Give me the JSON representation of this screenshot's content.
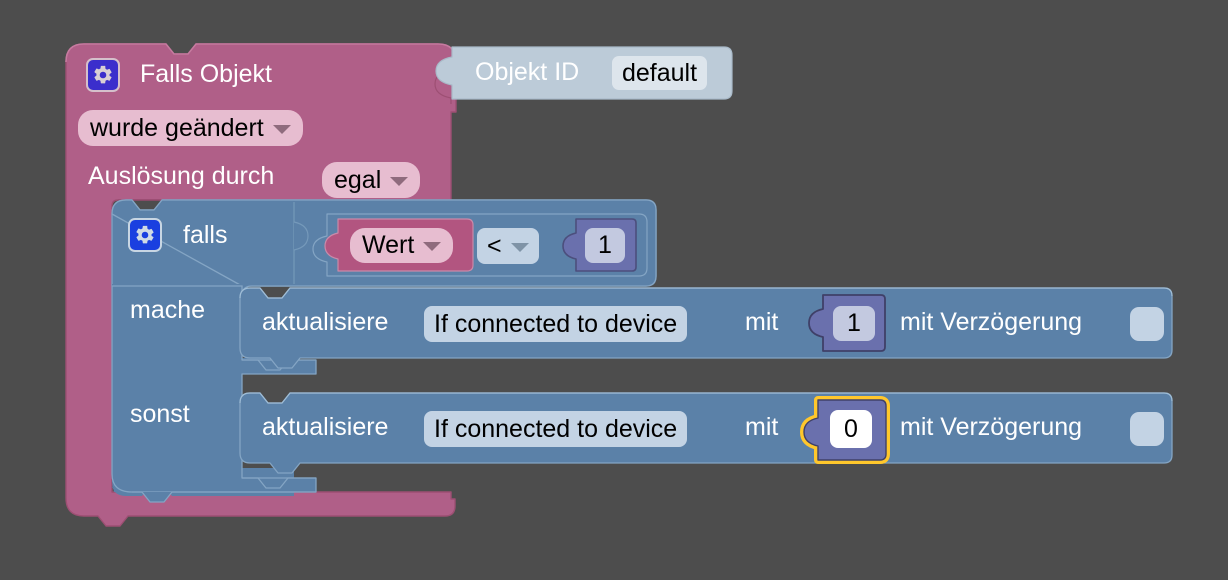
{
  "app": {
    "name": "blockly-workspace",
    "background_color": "#4d4d4d"
  },
  "colors": {
    "event_block": "#b05f88",
    "event_block_dark": "#a55679",
    "control_block": "#5b81a8",
    "control_block_light": "#6a8fb5",
    "value_block_light_blue": "#bccbd8",
    "compare_field": "#c3d3e4",
    "number_block": "#6a70ad",
    "variable_block": "#b25580",
    "selection_highlight": "#ffc72c",
    "mutator_icon_outer": "#3b2ecc",
    "mutator_icon_inner": "#1a3fe0"
  },
  "event_block": {
    "name": "Falls Objekt",
    "mutator_icon": "gear-icon",
    "title": "Falls Objekt",
    "trigger_dropdown": {
      "value": "wurde geändert",
      "icon": "chevron-down-icon"
    },
    "source_label": "Auslösung durch",
    "source_dropdown": {
      "value": "egal",
      "icon": "chevron-down-icon"
    }
  },
  "object_id_block": {
    "label": "Objekt ID",
    "value": "default"
  },
  "if_block": {
    "mutator_icon": "gear-icon",
    "if_label": "falls",
    "do_label": "mache",
    "else_label": "sonst",
    "condition": {
      "left_operand": {
        "value": "Wert",
        "icon": "chevron-down-icon"
      },
      "operator": {
        "value": "<",
        "icon": "chevron-down-icon"
      },
      "right_operand": {
        "value": "1"
      }
    }
  },
  "statements": [
    {
      "action_label": "aktualisiere",
      "target": "If connected to device",
      "with_label": "mit",
      "value": "1",
      "delay_label": "mit Verzögerung",
      "delay_value": "",
      "selected": false
    },
    {
      "action_label": "aktualisiere",
      "target": "If connected to device",
      "with_label": "mit",
      "value": "0",
      "delay_label": "mit Verzögerung",
      "delay_value": "",
      "selected": true
    }
  ]
}
